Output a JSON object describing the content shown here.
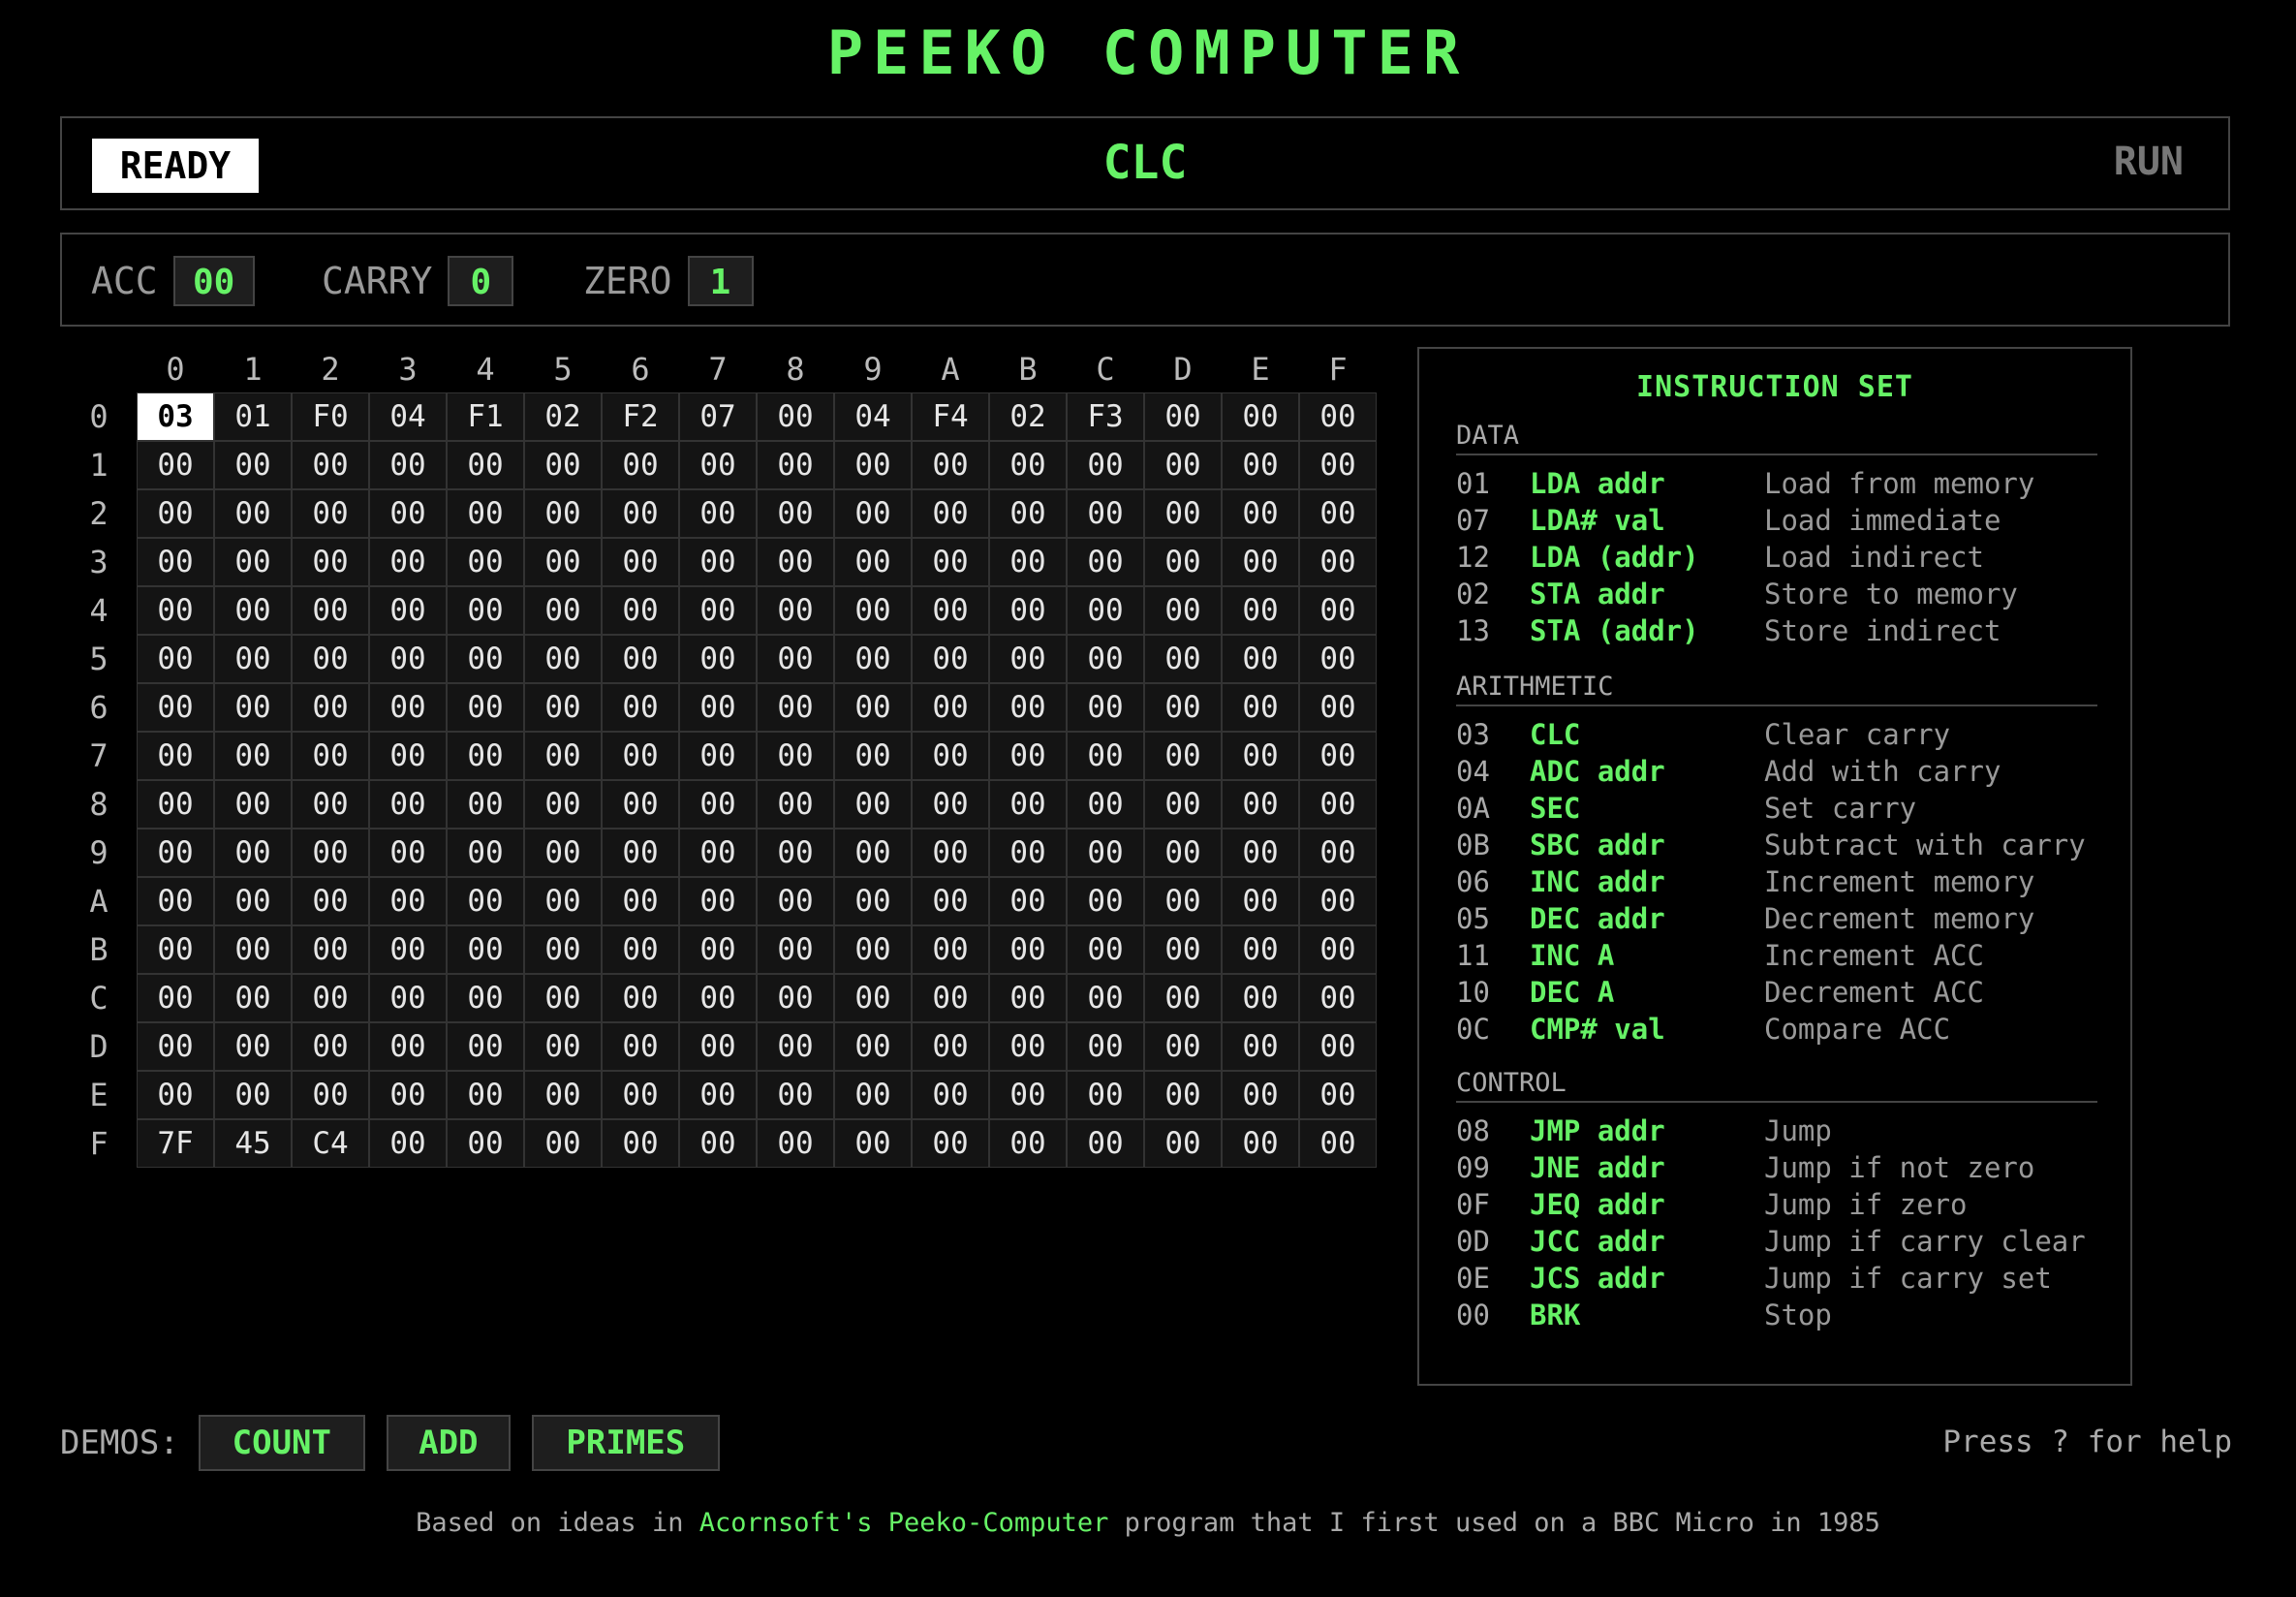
{
  "title": "PEEKO COMPUTER",
  "status": {
    "state": "READY",
    "current_instruction": "CLC",
    "run_label": "RUN"
  },
  "registers": [
    {
      "label": "ACC",
      "value": "00"
    },
    {
      "label": "CARRY",
      "value": "0"
    },
    {
      "label": "ZERO",
      "value": "1"
    }
  ],
  "memory": {
    "col_headers": [
      "0",
      "1",
      "2",
      "3",
      "4",
      "5",
      "6",
      "7",
      "8",
      "9",
      "A",
      "B",
      "C",
      "D",
      "E",
      "F"
    ],
    "row_headers": [
      "0",
      "1",
      "2",
      "3",
      "4",
      "5",
      "6",
      "7",
      "8",
      "9",
      "A",
      "B",
      "C",
      "D",
      "E",
      "F"
    ],
    "selected_address": "00",
    "rows": [
      [
        "03",
        "01",
        "F0",
        "04",
        "F1",
        "02",
        "F2",
        "07",
        "00",
        "04",
        "F4",
        "02",
        "F3",
        "00",
        "00",
        "00"
      ],
      [
        "00",
        "00",
        "00",
        "00",
        "00",
        "00",
        "00",
        "00",
        "00",
        "00",
        "00",
        "00",
        "00",
        "00",
        "00",
        "00"
      ],
      [
        "00",
        "00",
        "00",
        "00",
        "00",
        "00",
        "00",
        "00",
        "00",
        "00",
        "00",
        "00",
        "00",
        "00",
        "00",
        "00"
      ],
      [
        "00",
        "00",
        "00",
        "00",
        "00",
        "00",
        "00",
        "00",
        "00",
        "00",
        "00",
        "00",
        "00",
        "00",
        "00",
        "00"
      ],
      [
        "00",
        "00",
        "00",
        "00",
        "00",
        "00",
        "00",
        "00",
        "00",
        "00",
        "00",
        "00",
        "00",
        "00",
        "00",
        "00"
      ],
      [
        "00",
        "00",
        "00",
        "00",
        "00",
        "00",
        "00",
        "00",
        "00",
        "00",
        "00",
        "00",
        "00",
        "00",
        "00",
        "00"
      ],
      [
        "00",
        "00",
        "00",
        "00",
        "00",
        "00",
        "00",
        "00",
        "00",
        "00",
        "00",
        "00",
        "00",
        "00",
        "00",
        "00"
      ],
      [
        "00",
        "00",
        "00",
        "00",
        "00",
        "00",
        "00",
        "00",
        "00",
        "00",
        "00",
        "00",
        "00",
        "00",
        "00",
        "00"
      ],
      [
        "00",
        "00",
        "00",
        "00",
        "00",
        "00",
        "00",
        "00",
        "00",
        "00",
        "00",
        "00",
        "00",
        "00",
        "00",
        "00"
      ],
      [
        "00",
        "00",
        "00",
        "00",
        "00",
        "00",
        "00",
        "00",
        "00",
        "00",
        "00",
        "00",
        "00",
        "00",
        "00",
        "00"
      ],
      [
        "00",
        "00",
        "00",
        "00",
        "00",
        "00",
        "00",
        "00",
        "00",
        "00",
        "00",
        "00",
        "00",
        "00",
        "00",
        "00"
      ],
      [
        "00",
        "00",
        "00",
        "00",
        "00",
        "00",
        "00",
        "00",
        "00",
        "00",
        "00",
        "00",
        "00",
        "00",
        "00",
        "00"
      ],
      [
        "00",
        "00",
        "00",
        "00",
        "00",
        "00",
        "00",
        "00",
        "00",
        "00",
        "00",
        "00",
        "00",
        "00",
        "00",
        "00"
      ],
      [
        "00",
        "00",
        "00",
        "00",
        "00",
        "00",
        "00",
        "00",
        "00",
        "00",
        "00",
        "00",
        "00",
        "00",
        "00",
        "00"
      ],
      [
        "00",
        "00",
        "00",
        "00",
        "00",
        "00",
        "00",
        "00",
        "00",
        "00",
        "00",
        "00",
        "00",
        "00",
        "00",
        "00"
      ],
      [
        "7F",
        "45",
        "C4",
        "00",
        "00",
        "00",
        "00",
        "00",
        "00",
        "00",
        "00",
        "00",
        "00",
        "00",
        "00",
        "00"
      ]
    ]
  },
  "instruction_set": {
    "title": "INSTRUCTION SET",
    "sections": [
      {
        "name": "DATA",
        "items": [
          {
            "code": "01",
            "mnemonic": "LDA addr",
            "desc": "Load from memory"
          },
          {
            "code": "07",
            "mnemonic": "LDA# val",
            "desc": "Load immediate"
          },
          {
            "code": "12",
            "mnemonic": "LDA (addr)",
            "desc": "Load indirect"
          },
          {
            "code": "02",
            "mnemonic": "STA addr",
            "desc": "Store to memory"
          },
          {
            "code": "13",
            "mnemonic": "STA (addr)",
            "desc": "Store indirect"
          }
        ]
      },
      {
        "name": "ARITHMETIC",
        "items": [
          {
            "code": "03",
            "mnemonic": "CLC",
            "desc": "Clear carry"
          },
          {
            "code": "04",
            "mnemonic": "ADC addr",
            "desc": "Add with carry"
          },
          {
            "code": "0A",
            "mnemonic": "SEC",
            "desc": "Set carry"
          },
          {
            "code": "0B",
            "mnemonic": "SBC addr",
            "desc": "Subtract with carry"
          },
          {
            "code": "06",
            "mnemonic": "INC addr",
            "desc": "Increment memory"
          },
          {
            "code": "05",
            "mnemonic": "DEC addr",
            "desc": "Decrement memory"
          },
          {
            "code": "11",
            "mnemonic": "INC A",
            "desc": "Increment ACC"
          },
          {
            "code": "10",
            "mnemonic": "DEC A",
            "desc": "Decrement ACC"
          },
          {
            "code": "0C",
            "mnemonic": "CMP# val",
            "desc": "Compare ACC"
          }
        ]
      },
      {
        "name": "CONTROL",
        "items": [
          {
            "code": "08",
            "mnemonic": "JMP addr",
            "desc": "Jump"
          },
          {
            "code": "09",
            "mnemonic": "JNE addr",
            "desc": "Jump if not zero"
          },
          {
            "code": "0F",
            "mnemonic": "JEQ addr",
            "desc": "Jump if zero"
          },
          {
            "code": "0D",
            "mnemonic": "JCC addr",
            "desc": "Jump if carry clear"
          },
          {
            "code": "0E",
            "mnemonic": "JCS addr",
            "desc": "Jump if carry set"
          },
          {
            "code": "00",
            "mnemonic": "BRK",
            "desc": "Stop"
          }
        ]
      }
    ]
  },
  "demos": {
    "label": "DEMOS:",
    "buttons": [
      "COUNT",
      "ADD",
      "PRIMES"
    ]
  },
  "help_hint": "Press ? for help",
  "footer": {
    "prefix": "Based on ideas in ",
    "link_text": "Acornsoft's Peeko-Computer",
    "suffix": " program that I first used on a BBC Micro in 1985"
  },
  "colors": {
    "accent": "#66f266",
    "background": "#000000",
    "panel_border": "#444444"
  }
}
